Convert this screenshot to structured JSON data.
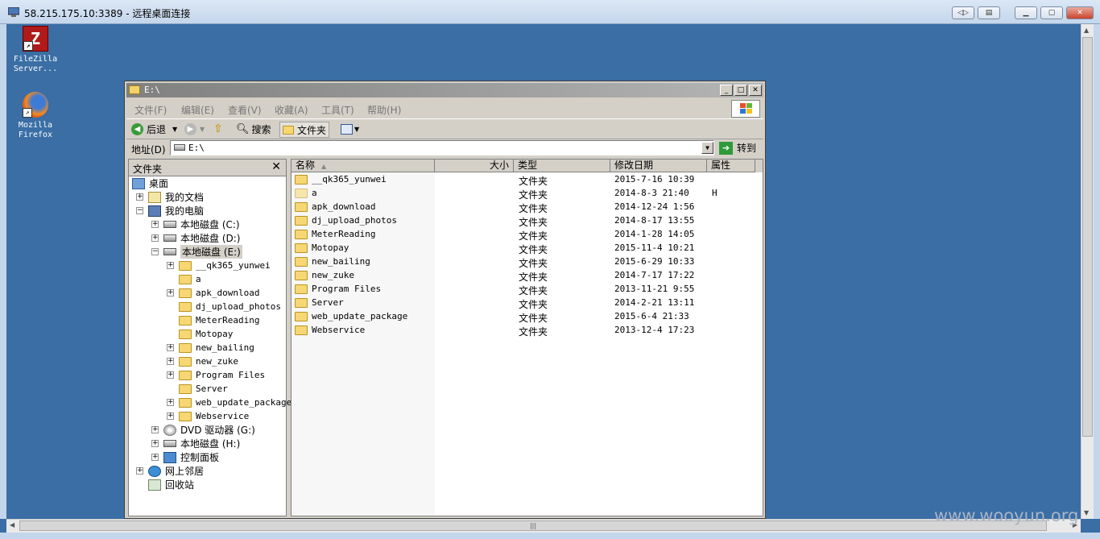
{
  "rdp": {
    "title": "58.215.175.10:3389 - 远程桌面连接"
  },
  "desktop": {
    "icons": [
      {
        "label": "FileZilla Server...",
        "icon": "filezilla-icon"
      },
      {
        "label": "Mozilla Firefox",
        "icon": "firefox-icon"
      }
    ]
  },
  "explorer": {
    "title": "E:\\",
    "menu": [
      "文件(F)",
      "编辑(E)",
      "查看(V)",
      "收藏(A)",
      "工具(T)",
      "帮助(H)"
    ],
    "toolbar": {
      "back": "后退",
      "search": "搜索",
      "folders": "文件夹"
    },
    "address": {
      "label": "地址(D)",
      "value": "E:\\",
      "go": "转到"
    },
    "tree": {
      "header": "文件夹",
      "items": [
        {
          "label": "桌面"
        },
        {
          "label": "我的文档"
        },
        {
          "label": "我的电脑"
        },
        {
          "label": "本地磁盘 (C:)"
        },
        {
          "label": "本地磁盘 (D:)"
        },
        {
          "label": "本地磁盘 (E:)"
        },
        {
          "label": "__qk365_yunwei"
        },
        {
          "label": "a"
        },
        {
          "label": "apk_download"
        },
        {
          "label": "dj_upload_photos"
        },
        {
          "label": "MeterReading"
        },
        {
          "label": "Motopay"
        },
        {
          "label": "new_bailing"
        },
        {
          "label": "new_zuke"
        },
        {
          "label": "Program Files"
        },
        {
          "label": "Server"
        },
        {
          "label": "web_update_package"
        },
        {
          "label": "Webservice"
        },
        {
          "label": "DVD 驱动器 (G:)"
        },
        {
          "label": "本地磁盘 (H:)"
        },
        {
          "label": "控制面板"
        },
        {
          "label": "网上邻居"
        },
        {
          "label": "回收站"
        }
      ]
    },
    "list": {
      "columns": {
        "name": "名称",
        "size": "大小",
        "type": "类型",
        "modified": "修改日期",
        "attr": "属性"
      },
      "rows": [
        {
          "name": "__qk365_yunwei",
          "type": "文件夹",
          "modified": "2015-7-16 10:39",
          "attr": ""
        },
        {
          "name": "a",
          "type": "文件夹",
          "modified": "2014-8-3 21:40",
          "attr": "H"
        },
        {
          "name": "apk_download",
          "type": "文件夹",
          "modified": "2014-12-24 1:56",
          "attr": ""
        },
        {
          "name": "dj_upload_photos",
          "type": "文件夹",
          "modified": "2014-8-17 13:55",
          "attr": ""
        },
        {
          "name": "MeterReading",
          "type": "文件夹",
          "modified": "2014-1-28 14:05",
          "attr": ""
        },
        {
          "name": "Motopay",
          "type": "文件夹",
          "modified": "2015-11-4 10:21",
          "attr": ""
        },
        {
          "name": "new_bailing",
          "type": "文件夹",
          "modified": "2015-6-29 10:33",
          "attr": ""
        },
        {
          "name": "new_zuke",
          "type": "文件夹",
          "modified": "2014-7-17 17:22",
          "attr": ""
        },
        {
          "name": "Program Files",
          "type": "文件夹",
          "modified": "2013-11-21 9:55",
          "attr": ""
        },
        {
          "name": "Server",
          "type": "文件夹",
          "modified": "2014-2-21 13:11",
          "attr": ""
        },
        {
          "name": "web_update_package",
          "type": "文件夹",
          "modified": "2015-6-4 21:33",
          "attr": ""
        },
        {
          "name": "Webservice",
          "type": "文件夹",
          "modified": "2013-12-4 17:23",
          "attr": ""
        }
      ]
    }
  },
  "watermark": "www.wooyun.org"
}
